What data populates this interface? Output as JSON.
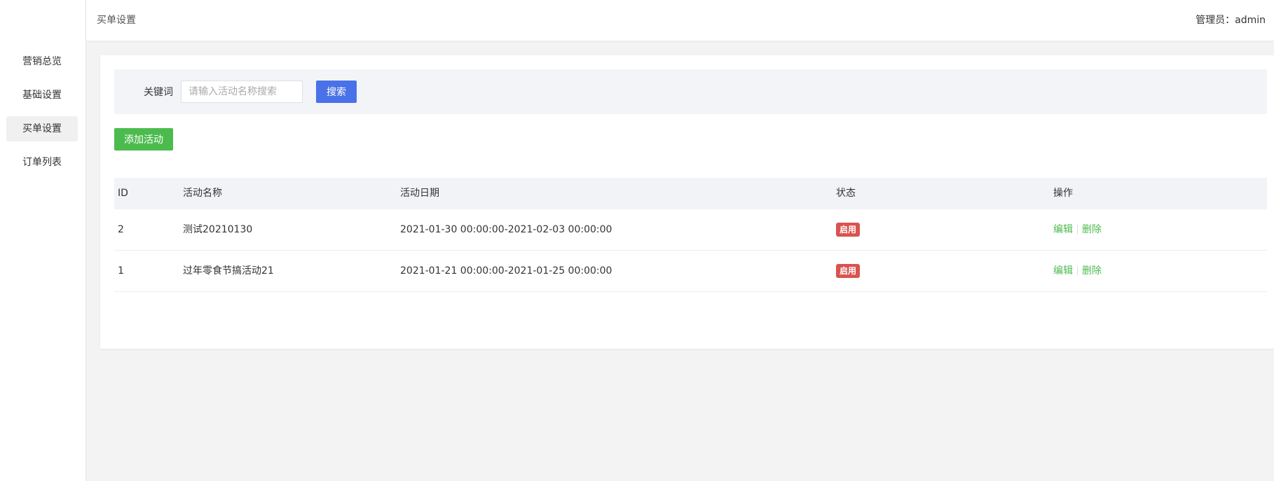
{
  "sidebar": {
    "items": [
      {
        "label": "营销总览",
        "active": false
      },
      {
        "label": "基础设置",
        "active": false
      },
      {
        "label": "买单设置",
        "active": true
      },
      {
        "label": "订单列表",
        "active": false
      }
    ]
  },
  "header": {
    "breadcrumb": "买单设置",
    "admin_label": "管理员：",
    "admin_name": "admin"
  },
  "search": {
    "label": "关键词",
    "placeholder": "请输入活动名称搜索",
    "value": "",
    "button_label": "搜索"
  },
  "toolbar": {
    "add_label": "添加活动"
  },
  "table": {
    "columns": [
      "ID",
      "活动名称",
      "活动日期",
      "状态",
      "操作"
    ],
    "rows": [
      {
        "id": "2",
        "name": "测试20210130",
        "date": "2021-01-30 00:00:00-2021-02-03 00:00:00",
        "status": "启用",
        "edit": "编辑",
        "delete": "删除"
      },
      {
        "id": "1",
        "name": "过年零食节搞活动21",
        "date": "2021-01-21 00:00:00-2021-01-25 00:00:00",
        "status": "启用",
        "edit": "编辑",
        "delete": "删除"
      }
    ]
  },
  "colors": {
    "primary": "#4a72e8",
    "success": "#4cbb4e",
    "danger": "#d9534f"
  }
}
